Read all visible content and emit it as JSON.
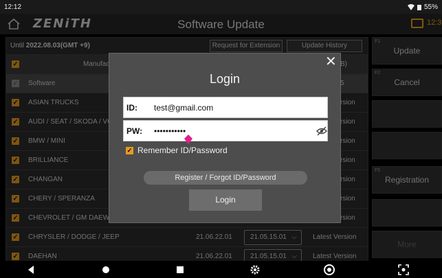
{
  "status": {
    "time": "12:12",
    "battery": "55%"
  },
  "app": {
    "logo": "ZENiTH",
    "title": "Software Update",
    "battery_time": "12:3"
  },
  "header": {
    "until_prefix": "Until",
    "until_date": "2022.08.03(GMT +9)",
    "request_extension": "Request for Extension",
    "update_history": "Update History"
  },
  "table": {
    "manufacturer_header": "Manufac",
    "header_tail": "B)",
    "rows": [
      {
        "name": "Software",
        "date": "",
        "selected": "",
        "status": "5"
      },
      {
        "name": "ASIAN TRUCKS",
        "date": "",
        "selected": "",
        "status": "rsion"
      },
      {
        "name": "AUDI / SEAT / SKODA / VO",
        "date": "",
        "selected": "",
        "status": "rsion"
      },
      {
        "name": "BMW / MINI",
        "date": "",
        "selected": "",
        "status": "rsion"
      },
      {
        "name": "BRILLIANCE",
        "date": "",
        "selected": "",
        "status": "rsion"
      },
      {
        "name": "CHANGAN",
        "date": "",
        "selected": "",
        "status": "rsion"
      },
      {
        "name": "CHERY / SPERANZA",
        "date": "",
        "selected": "",
        "status": "rsion"
      },
      {
        "name": "CHEVROLET / GM DAEWO",
        "date": "",
        "selected": "",
        "status": "rsion"
      },
      {
        "name": "CHRYSLER / DODGE / JEEP",
        "date": "21.06.22.01",
        "selected": "21.05.15.01",
        "status": "Latest Version"
      },
      {
        "name": "DAEHAN",
        "date": "21.06.22.01",
        "selected": "21.05.15.01",
        "status": "Latest Version"
      }
    ]
  },
  "sidebar": {
    "buttons": [
      {
        "fkey": "F1",
        "label": "Update"
      },
      {
        "fkey": "F2",
        "label": "Cancel"
      },
      {
        "fkey": "",
        "label": ""
      },
      {
        "fkey": "",
        "label": ""
      },
      {
        "fkey": "F5",
        "label": "Registration"
      },
      {
        "fkey": "",
        "label": ""
      },
      {
        "fkey": "",
        "label": "More"
      }
    ]
  },
  "login": {
    "title": "Login",
    "id_label": "ID:",
    "id_value": "test@gmail.com",
    "pw_label": "PW:",
    "pw_value": "•••••••••••",
    "remember_label": "Remember ID/Password",
    "register_link": "Register / Forgot ID/Password",
    "login_button": "Login"
  },
  "colors": {
    "accent": "#e39a22",
    "cursor": "#e0208a"
  }
}
